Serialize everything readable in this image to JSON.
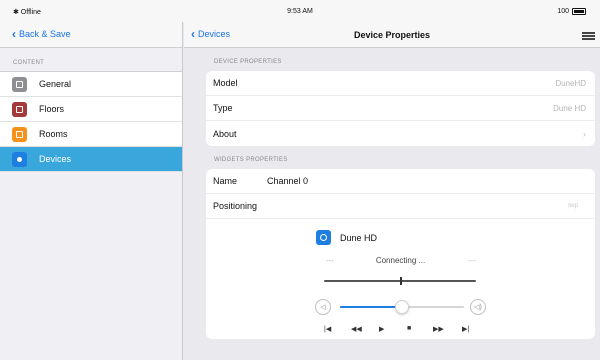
{
  "status_bar": {
    "carrier": "✱ Offline",
    "time": "9:53 AM",
    "battery": "100"
  },
  "left_nav": {
    "back_label": "Back & Save"
  },
  "sidebar": {
    "section_title": "CONTENT",
    "items": [
      {
        "label": "General",
        "icon": "gear-icon",
        "color": "#8e8e93"
      },
      {
        "label": "Floors",
        "icon": "floors-icon",
        "color": "#a33a3a"
      },
      {
        "label": "Rooms",
        "icon": "rooms-icon",
        "color": "#f5921e"
      },
      {
        "label": "Devices",
        "icon": "devices-icon",
        "color": "#1e7fe0",
        "active": true
      }
    ]
  },
  "right_nav": {
    "back_label": "Devices",
    "title": "Device Properties"
  },
  "device_properties": {
    "section_title": "DEVICE PROPERTIES",
    "model_label": "Model",
    "model_value": "DuneHD",
    "type_label": "Type",
    "type_value": "Dune HD",
    "about_label": "About",
    "about_chevron": "›"
  },
  "widgets_properties": {
    "section_title": "WIDGETS PROPERTIES",
    "name_label": "Name",
    "name_value": "Channel 0",
    "positioning_label": "Positioning",
    "positioning_value": "пер"
  },
  "player": {
    "device_name": "Dune HD",
    "status_text": "Connecting ...",
    "dash_left": "---",
    "dash_right": "---",
    "progress": 0.5,
    "volume": 0.5,
    "vol_down_symbol": "◁",
    "vol_up_symbol": "◁)",
    "transport": {
      "prev": "|◀",
      "rewind": "◀◀",
      "play": "▶",
      "stop": "■",
      "forward": "▶▶",
      "next": "▶|"
    }
  },
  "colors": {
    "accent": "#1e7fe0",
    "selected_row": "#39a6dc"
  }
}
